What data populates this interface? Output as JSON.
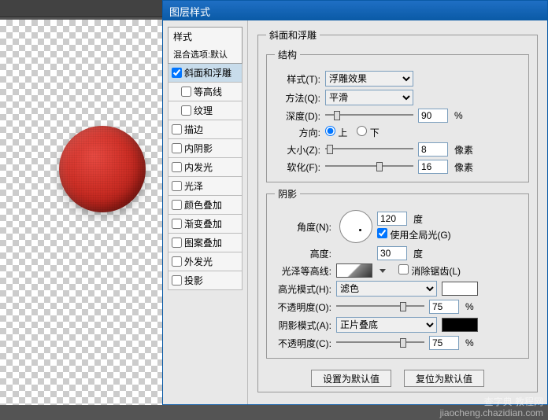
{
  "dialog": {
    "title": "图层样式",
    "sidebar": {
      "header": "样式",
      "blend_options": "混合选项:默认",
      "items": [
        {
          "label": "斜面和浮雕",
          "checked": true,
          "selected": true
        },
        {
          "label": "等高线",
          "checked": false,
          "nested": true
        },
        {
          "label": "纹理",
          "checked": false,
          "nested": true
        },
        {
          "label": "描边",
          "checked": false
        },
        {
          "label": "内阴影",
          "checked": false
        },
        {
          "label": "内发光",
          "checked": false
        },
        {
          "label": "光泽",
          "checked": false
        },
        {
          "label": "颜色叠加",
          "checked": false
        },
        {
          "label": "渐变叠加",
          "checked": false
        },
        {
          "label": "图案叠加",
          "checked": false
        },
        {
          "label": "外发光",
          "checked": false
        },
        {
          "label": "投影",
          "checked": false
        }
      ]
    },
    "main_group": "斜面和浮雕",
    "structure": {
      "legend": "结构",
      "style_label": "样式(T):",
      "style_value": "浮雕效果",
      "technique_label": "方法(Q):",
      "technique_value": "平滑",
      "depth_label": "深度(D):",
      "depth_value": "90",
      "depth_unit": "%",
      "direction_label": "方向:",
      "direction_up": "上",
      "direction_down": "下",
      "size_label": "大小(Z):",
      "size_value": "8",
      "size_unit": "像素",
      "soften_label": "软化(F):",
      "soften_value": "16",
      "soften_unit": "像素"
    },
    "shading": {
      "legend": "阴影",
      "angle_label": "角度(N):",
      "angle_value": "120",
      "angle_unit": "度",
      "global_light": "使用全局光(G)",
      "altitude_label": "高度:",
      "altitude_value": "30",
      "altitude_unit": "度",
      "contour_label": "光泽等高线:",
      "antialias": "消除锯齿(L)",
      "highlight_mode_label": "高光模式(H):",
      "highlight_mode_value": "滤色",
      "highlight_opacity_label": "不透明度(O):",
      "highlight_opacity_value": "75",
      "highlight_opacity_unit": "%",
      "shadow_mode_label": "阴影模式(A):",
      "shadow_mode_value": "正片叠底",
      "shadow_opacity_label": "不透明度(C):",
      "shadow_opacity_value": "75",
      "shadow_opacity_unit": "%"
    },
    "buttons": {
      "make_default": "设置为默认值",
      "reset_default": "复位为默认值"
    }
  },
  "watermark": {
    "line1": "查字典 教程网",
    "line2": "jiaocheng.chazidian.com"
  }
}
